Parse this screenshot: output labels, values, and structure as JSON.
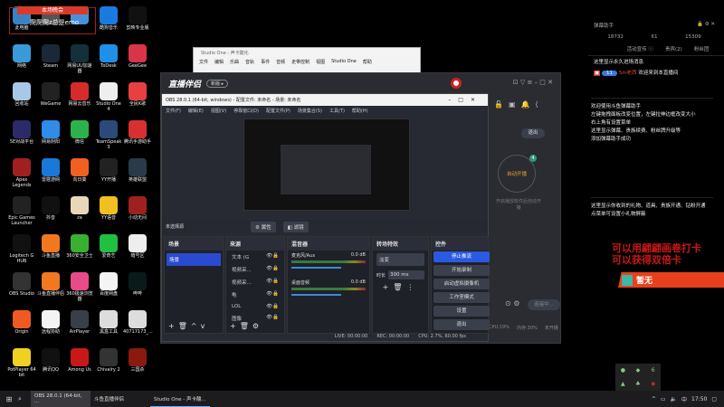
{
  "desktop": {
    "banner": "本场晚会",
    "banner_sub": "爬爬爬z总是emo",
    "icons": [
      [
        {
          "l": "此电脑",
          "c": "#3b82c4"
        },
        {
          "l": "",
          "c": "#555"
        },
        {
          "l": "",
          "c": "#4a90d9"
        },
        {
          "l": "酷狗音乐",
          "c": "#1a7ae0"
        },
        {
          "l": "剪映专业版",
          "c": "#111"
        }
      ],
      [
        {
          "l": "网络",
          "c": "#3a9ad9"
        },
        {
          "l": "Steam",
          "c": "#1b2838"
        },
        {
          "l": "网易UU加速器",
          "c": "#14303a"
        },
        {
          "l": "ToDesk",
          "c": "#1f8fe8"
        },
        {
          "l": "GeeGee",
          "c": "#d8354a"
        }
      ],
      [
        {
          "l": "回收站",
          "c": "#a8c8e8"
        },
        {
          "l": "WeGame",
          "c": "#222"
        },
        {
          "l": "网易云音乐",
          "c": "#d52b2b"
        },
        {
          "l": "Studio One 4",
          "c": "#eee"
        },
        {
          "l": "全民K歌",
          "c": "#e84040"
        }
      ],
      [
        {
          "l": "5E对战平台",
          "c": "#2d2a6a"
        },
        {
          "l": "网易阴阳",
          "c": "#2f8ce8"
        },
        {
          "l": "微信",
          "c": "#2cb24a"
        },
        {
          "l": "TeamSpeak 3",
          "c": "#2a4a7a"
        },
        {
          "l": "腾讯手游助手",
          "c": "#d83030"
        }
      ],
      [
        {
          "l": "Apex Legends",
          "c": "#a02020"
        },
        {
          "l": "雷霆游网",
          "c": "#1a78d8"
        },
        {
          "l": "向日葵",
          "c": "#f06020"
        },
        {
          "l": "YY开播",
          "c": "#222"
        },
        {
          "l": "英雄联盟",
          "c": "#2a3a4a"
        }
      ],
      [
        {
          "l": "Epic Games Launcher",
          "c": "#222"
        },
        {
          "l": "抖音",
          "c": "#111"
        },
        {
          "l": "za",
          "c": "#e8d8b8"
        },
        {
          "l": "YY语音",
          "c": "#f0c020"
        },
        {
          "l": "小动无间",
          "c": "#a02020"
        }
      ],
      [
        {
          "l": "Logitech G HUB",
          "c": "#111"
        },
        {
          "l": "斗鱼直播",
          "c": "#f07820"
        },
        {
          "l": "360安全卫士",
          "c": "#3ab030"
        },
        {
          "l": "爱奇艺",
          "c": "#20c040"
        },
        {
          "l": "暗号区",
          "c": "#eee"
        }
      ],
      [
        {
          "l": "OBS Studio",
          "c": "#333"
        },
        {
          "l": "斗鱼直播伴侣",
          "c": "#f07820"
        },
        {
          "l": "360极速浏览器",
          "c": "#e84a8a"
        },
        {
          "l": "百度网盘",
          "c": "#f4f4f4"
        },
        {
          "l": "哔哔",
          "c": "#0a1a1a"
        }
      ],
      [
        {
          "l": "Origin",
          "c": "#f05a20"
        },
        {
          "l": "远程协助",
          "c": "#f4f4f4"
        },
        {
          "l": "AirPlayer",
          "c": "#3a3e48"
        },
        {
          "l": "黑盒工具",
          "c": "#ddd"
        },
        {
          "l": "40717173_...",
          "c": "#ddd"
        }
      ],
      [
        {
          "l": "PotPlayer 64 bit",
          "c": "#f0d020"
        },
        {
          "l": "腾讯QQ",
          "c": "#111"
        },
        {
          "l": "Among Us",
          "c": "#c81818"
        },
        {
          "l": "Chivalry 2",
          "c": "#333"
        },
        {
          "l": "三国杀",
          "c": "#8a1a10"
        }
      ]
    ]
  },
  "studio_one": {
    "title": "Studio One - 声卡酸化",
    "menu": [
      "文件",
      "编辑",
      "乐曲",
      "音轨",
      "事件",
      "音频",
      "走带控制",
      "视图",
      "Studio One",
      "帮助"
    ]
  },
  "zbbl": {
    "logo": "直播伴侣",
    "badge": "新版 ▸",
    "exit": "退出",
    "auto_live": "自动开播",
    "auto_live_badge": "4",
    "auto_hint": "开启播放软件后自动开播",
    "connecting": "连接中...",
    "status": {
      "cpu": "CPU:19%",
      "mem": "内存:30%",
      "live": "未开播"
    }
  },
  "obs": {
    "title": "OBS 28.0.1 (64-bit, windows) - 配置文件: 未命名 - 场景: 未命名",
    "menu": [
      "文件(F)",
      "编辑(E)",
      "视图(V)",
      "停靠窗口(D)",
      "配置文件(P)",
      "场景集合(S)",
      "工具(T)",
      "帮助(H)"
    ],
    "no_source": "未选择源",
    "properties": "属性",
    "filters": "滤镜",
    "scenes": {
      "title": "场景",
      "items": [
        "场景"
      ]
    },
    "sources": {
      "title": "来源",
      "items": [
        "文本 (G",
        "视频采...",
        "视频采...",
        "龟",
        "LOL",
        "图像"
      ]
    },
    "mixer": {
      "title": "混音器",
      "channels": [
        {
          "name": "麦克风/Aux",
          "db": "0.0 dB"
        },
        {
          "name": "桌面音频",
          "db": "0.0 dB"
        }
      ]
    },
    "transitions": {
      "title": "转场特效",
      "type": "淡变",
      "duration_label": "时长",
      "duration": "300 ms"
    },
    "controls": {
      "title": "控件",
      "buttons": [
        "停止推流",
        "开始录制",
        "启动虚拟摄像机",
        "工作室模式",
        "设置",
        "退出"
      ]
    },
    "status": {
      "live": "LIVE: 00:00:00",
      "rec": "REC: 00:00:00",
      "cpu": "CPU: 2.7%, 60.00 fps"
    }
  },
  "danmu": {
    "title": "弹幕助手",
    "stats": [
      "18732",
      "61",
      "15309"
    ],
    "tabs": [
      "活动宣传 ⓘ",
      "贵宾(2)",
      "粉丝团"
    ],
    "enter_hint": "这里显示永久进场消息",
    "level": "11",
    "user": "5m老西",
    "welcome": "欢迎来到本直播间",
    "messages": [
      "欢迎使用斗鱼弹幕助手",
      "左键拖拽面板改变位置，左键拉伸边框改变大小",
      "右上角有设置菜单",
      "这里显示弹幕、贵族续费、粉丝牌升级等",
      "添加弹幕助手成功"
    ],
    "gift_msgs": [
      "这里显示你收到的礼物、道具、贵族开通、钻粉开通",
      "点菜单可设置小礼物屏蔽"
    ]
  },
  "overlay": {
    "line1": "可以用翩翩画卷打卡",
    "line2": "可以获得双倍卡",
    "banner": "暂无",
    "accent": "#e8401c"
  },
  "taskbar": {
    "items": [
      "OBS 28.0.1 (64-bit, ...",
      "斗鱼直播伴侣",
      "Studio One - 声卡酸..."
    ],
    "ime": "中",
    "time": "17:50"
  }
}
